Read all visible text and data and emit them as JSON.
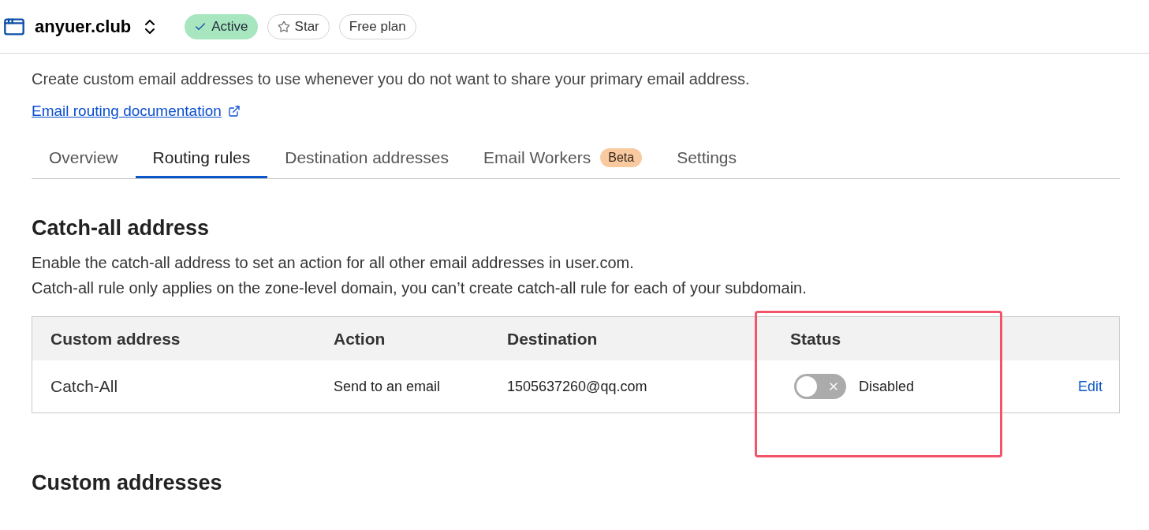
{
  "header": {
    "domain": "anyuer.club",
    "badges": [
      {
        "label": "Active",
        "kind": "status"
      },
      {
        "label": "Star",
        "kind": "star"
      },
      {
        "label": "Free plan",
        "kind": "plan"
      }
    ]
  },
  "intro": {
    "description": "Create custom email addresses to use whenever you do not want to share your primary email address.",
    "doc_link": "Email routing documentation"
  },
  "tabs": [
    {
      "label": "Overview",
      "selected": false
    },
    {
      "label": "Routing rules",
      "selected": true
    },
    {
      "label": "Destination addresses",
      "selected": false
    },
    {
      "label": "Email Workers",
      "selected": false,
      "badge": "Beta"
    },
    {
      "label": "Settings",
      "selected": false
    }
  ],
  "catch_all": {
    "title": "Catch-all address",
    "lines": [
      "Enable the catch-all address to set an action for all other email addresses in user.com.",
      "Catch-all rule only applies on the zone-level domain, you can’t create catch-all rule for each of your subdomain."
    ],
    "table": {
      "columns": [
        "Custom address",
        "Action",
        "Destination",
        "Status"
      ],
      "rows": [
        {
          "address": "Catch-All",
          "action": "Send to an email",
          "destination": "1505637260@qq.com",
          "on": false,
          "status": "Disabled",
          "edit": "Edit"
        }
      ]
    }
  },
  "custom": {
    "title": "Custom addresses"
  }
}
